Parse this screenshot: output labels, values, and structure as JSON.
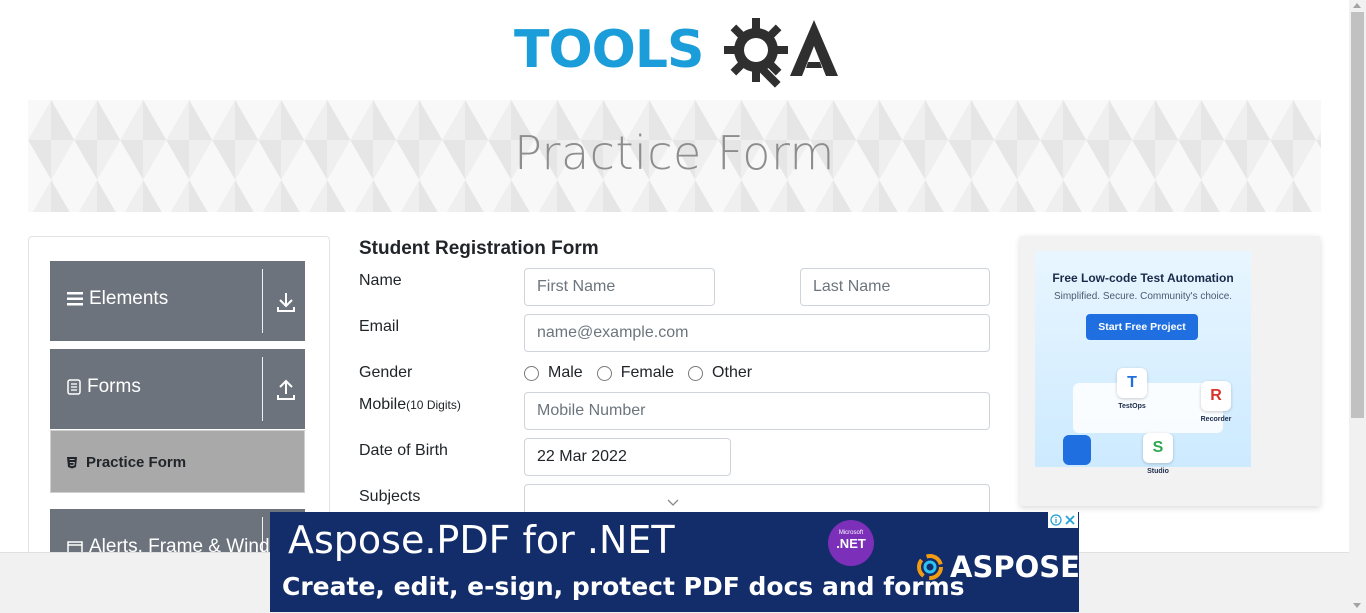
{
  "logo": {
    "text": "TOOLS",
    "suffix": "QA"
  },
  "banner": {
    "title": "Practice Form"
  },
  "sidebar": {
    "groups": [
      {
        "label": "Elements",
        "icon": "hamburger-icon",
        "toggle": "download-arrow-icon"
      },
      {
        "label": "Forms",
        "icon": "document-icon",
        "toggle": "upload-arrow-icon"
      },
      {
        "label": "Alerts, Frame & Windows",
        "icon": "window-icon",
        "toggle": ""
      }
    ],
    "active_item": {
      "label": "Practice Form",
      "icon": "html5-icon"
    }
  },
  "form": {
    "title": "Student Registration Form",
    "name_label": "Name",
    "first_name_placeholder": "First Name",
    "last_name_placeholder": "Last Name",
    "email_label": "Email",
    "email_placeholder": "name@example.com",
    "gender_label": "Gender",
    "gender_options": [
      "Male",
      "Female",
      "Other"
    ],
    "mobile_label": "Mobile",
    "mobile_hint": "(10 Digits)",
    "mobile_placeholder": "Mobile Number",
    "dob_label": "Date of Birth",
    "dob_value": "22 Mar 2022",
    "subjects_label": "Subjects"
  },
  "side_ad": {
    "title": "Free Low-code Test Automation",
    "subtitle": "Simplified. Secure. Community's choice.",
    "button": "Start Free Project",
    "chips": [
      "TestOps",
      "Recorder",
      "Studio"
    ]
  },
  "bottom_ad": {
    "headline": "Aspose.PDF for .NET",
    "tagline": "Create, edit, e-sign, protect PDF docs and forms",
    "badge_top": "Microsoft",
    "badge": ".NET",
    "brand": "ASPOSE"
  },
  "colors": {
    "sidebar_header": "#6c737d",
    "active_item": "#a9a9a9",
    "logo_blue": "#1a9dd9",
    "ad_button": "#1f6fe0",
    "bottom_ad_bg": "#132c6a"
  }
}
